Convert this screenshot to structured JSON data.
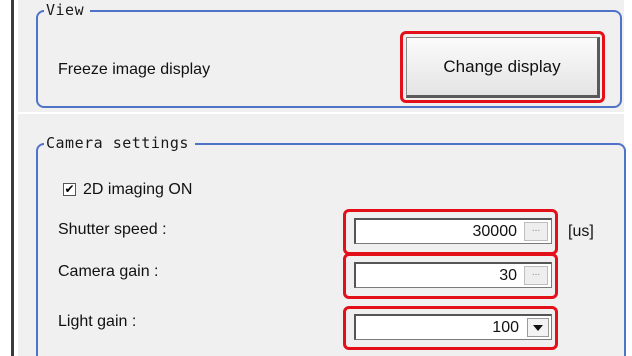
{
  "view_group": {
    "title": "View",
    "freeze_label": "Freeze image display",
    "change_button_label": "Change display"
  },
  "camera_group": {
    "title": "Camera settings",
    "imaging_checkbox_label": "2D imaging ON",
    "imaging_checked": true,
    "check_mark": "✔",
    "shutter_speed": {
      "label": "Shutter speed :",
      "value": "30000",
      "spin": "...",
      "unit": "[us]"
    },
    "camera_gain": {
      "label": "Camera gain :",
      "value": "30",
      "spin": "..."
    },
    "light_gain": {
      "label": "Light gain :",
      "value": "100"
    }
  },
  "colors": {
    "group_border": "#4e73c9",
    "highlight": "#e3101a",
    "panel_bg": "#f0f0f0"
  }
}
